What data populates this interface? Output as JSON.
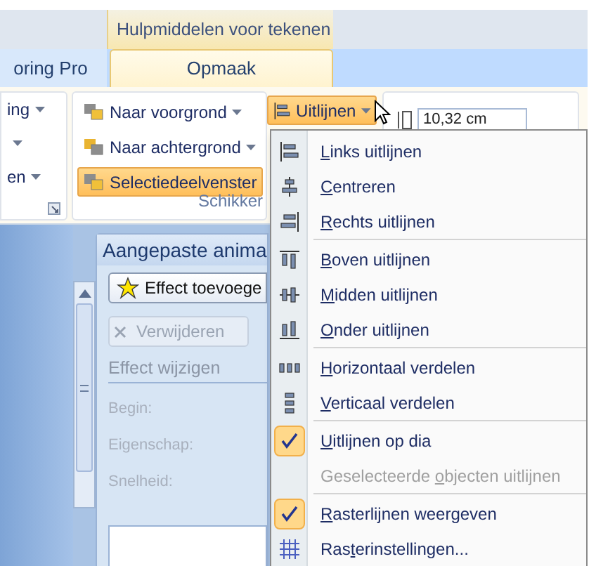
{
  "contextual_tab_header": "Hulpmiddelen voor tekenen",
  "tabs": [
    {
      "label": "oring Pro",
      "selected": false
    },
    {
      "label": "Opmaak",
      "selected": true
    }
  ],
  "ribbon": {
    "left_group": {
      "items": [
        {
          "label": "ing",
          "dropdown": true
        },
        {
          "dropdown": true
        },
        {
          "label": "en",
          "dropdown": true
        }
      ]
    },
    "arrange_group": {
      "buttons": [
        {
          "label": "Naar voorgrond",
          "dropdown": true,
          "highlighted": false
        },
        {
          "label": "Naar achtergrond",
          "dropdown": true,
          "highlighted": false
        },
        {
          "label": "Selectiedeelvenster",
          "dropdown": false,
          "highlighted": true
        }
      ],
      "align_button": {
        "label": "Uitlijnen",
        "highlighted": true
      },
      "group_label": "Schikker"
    },
    "size_group": {
      "width_value": "10,32 cm"
    }
  },
  "task_pane": {
    "title": "Aangepaste anima",
    "add_button": "Effect toevoege",
    "remove_button": {
      "label": "Verwijderen",
      "disabled": true
    },
    "section": "Effect wijzigen",
    "fields": [
      {
        "label": "Begin:",
        "disabled": true
      },
      {
        "label": "Eigenschap:",
        "disabled": true
      },
      {
        "label": "Snelheid:",
        "disabled": true
      }
    ]
  },
  "menu": {
    "groups": [
      [
        {
          "kind": "icon",
          "label": {
            "key": "L",
            "after": "inks uitlijnen"
          },
          "disabled": false
        },
        {
          "kind": "icon",
          "label": {
            "key": "C",
            "after": "entreren"
          },
          "disabled": false
        },
        {
          "kind": "icon",
          "label": {
            "key": "R",
            "after": "echts uitlijnen"
          },
          "disabled": false
        }
      ],
      [
        {
          "kind": "icon",
          "label": {
            "key": "B",
            "after": "oven uitlijnen"
          },
          "disabled": false
        },
        {
          "kind": "icon",
          "label": {
            "key": "M",
            "after": "idden uitlijnen"
          },
          "disabled": false
        },
        {
          "kind": "icon",
          "label": {
            "key": "O",
            "after": "nder uitlijnen"
          },
          "disabled": false
        }
      ],
      [
        {
          "kind": "icon",
          "label": {
            "key": "H",
            "after": "orizontaal verdelen"
          },
          "disabled": false
        },
        {
          "kind": "icon",
          "label": {
            "key": "V",
            "after": "erticaal verdelen"
          },
          "disabled": false
        }
      ],
      [
        {
          "kind": "check",
          "checked": true,
          "label": {
            "key": "U",
            "after": "itlijnen op dia"
          },
          "disabled": false
        },
        {
          "kind": "check",
          "checked": false,
          "label": {
            "before": "Geselecteerde ",
            "key": "o",
            "after": "bjecten uitlijnen"
          },
          "disabled": true
        }
      ],
      [
        {
          "kind": "check",
          "checked": true,
          "label": {
            "key": "R",
            "after": "asterlijnen weergeven"
          },
          "disabled": false
        },
        {
          "kind": "icon",
          "label": {
            "before": "Ras",
            "key": "t",
            "after": "erinstellingen..."
          },
          "disabled": false
        }
      ]
    ]
  }
}
